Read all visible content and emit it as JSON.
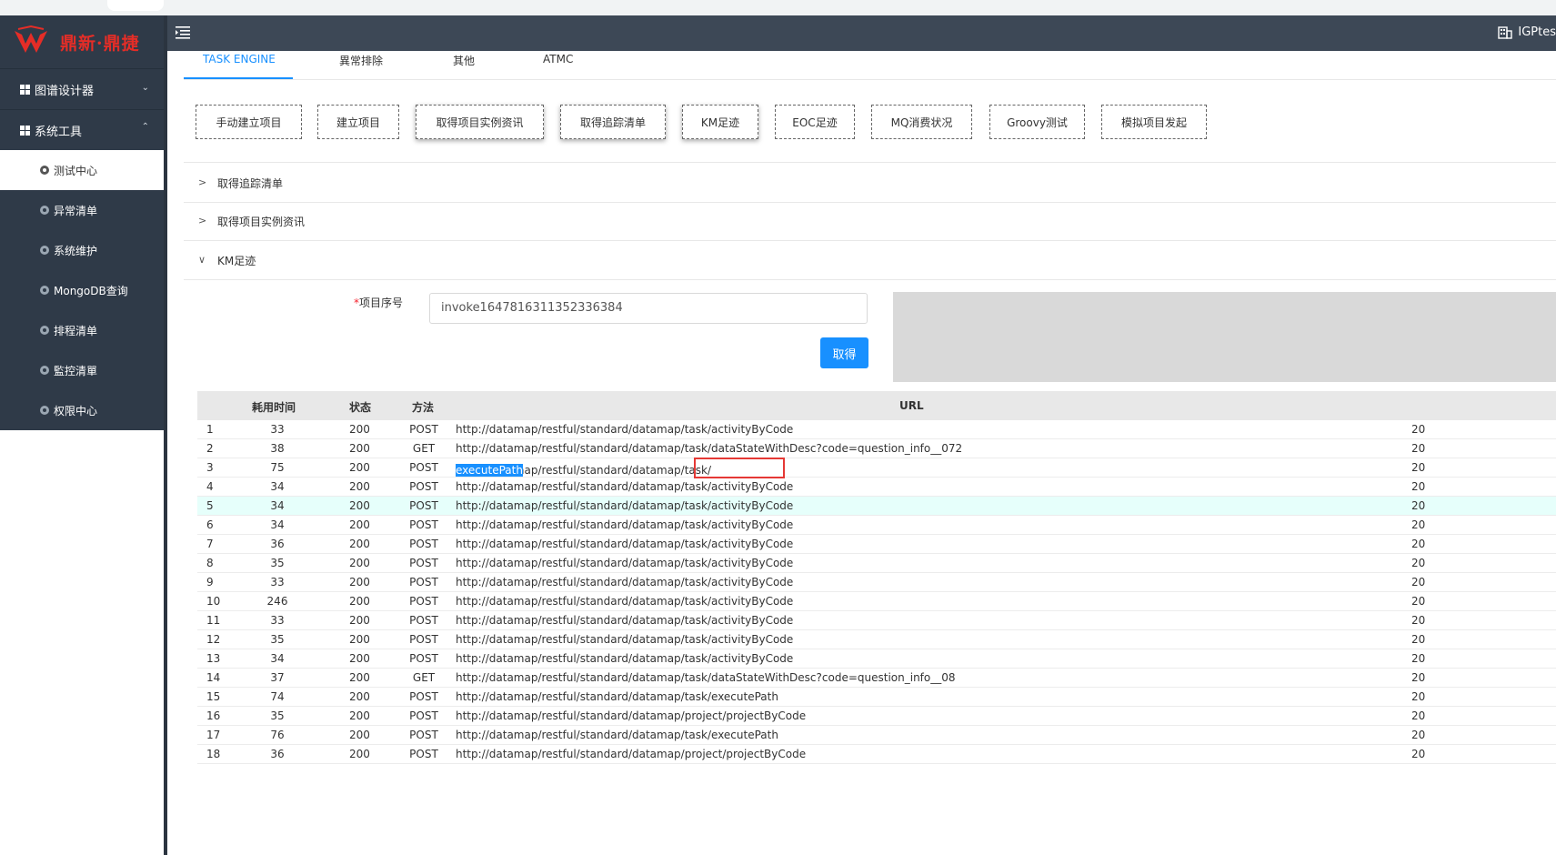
{
  "brand": {
    "logo_text": "鼎新·鼎捷",
    "accent": "#e52d27"
  },
  "header": {
    "tenant": "IGPtes"
  },
  "sidebar": {
    "groups": [
      {
        "label": "图谱设计器",
        "expanded": false
      },
      {
        "label": "系统工具",
        "expanded": true
      }
    ],
    "items": [
      {
        "label": "测试中心",
        "active": true
      },
      {
        "label": "异常清单"
      },
      {
        "label": "系统维护"
      },
      {
        "label": "MongoDB查询"
      },
      {
        "label": "排程清单"
      },
      {
        "label": "監控清單"
      },
      {
        "label": "权限中心"
      }
    ]
  },
  "tabs": [
    {
      "label": "TASK ENGINE",
      "active": true
    },
    {
      "label": "異常排除"
    },
    {
      "label": "其他"
    },
    {
      "label": "ATMC"
    }
  ],
  "actions": [
    "手动建立项目",
    "建立项目",
    "取得项目实例资讯",
    "取得追踪清单",
    "KM足迹",
    "EOC足迹",
    "MQ消费状况",
    "Groovy测试",
    "模拟项目发起"
  ],
  "panels": [
    {
      "title": "取得追踪清单",
      "expanded": false,
      "arrow": ">"
    },
    {
      "title": "取得项目实例资讯",
      "expanded": false,
      "arrow": ">"
    },
    {
      "title": "KM足迹",
      "expanded": true,
      "arrow": "∨"
    }
  ],
  "form": {
    "required_mark": "*",
    "label": "项目序号",
    "value": "invoke1647816311352336384",
    "submit": "取得"
  },
  "table": {
    "headers": {
      "time": "耗用时间",
      "status": "状态",
      "method": "方法",
      "url": "URL"
    },
    "rows": [
      {
        "idx": "1",
        "time": "33",
        "status": "200",
        "method": "POST",
        "url": "http://datamap/restful/standard/datamap/task/activityByCode",
        "date": "20"
      },
      {
        "idx": "2",
        "time": "38",
        "status": "200",
        "method": "GET",
        "url": "http://datamap/restful/standard/datamap/task/dataStateWithDesc?code=question_info__072",
        "date": "20"
      },
      {
        "idx": "3",
        "time": "75",
        "status": "200",
        "method": "POST",
        "url_prefix": "http://datamap/restful/standard/datamap/task/",
        "url_selected": "executePath",
        "date": "20"
      },
      {
        "idx": "4",
        "time": "34",
        "status": "200",
        "method": "POST",
        "url": "http://datamap/restful/standard/datamap/task/activityByCode",
        "date": "20"
      },
      {
        "idx": "5",
        "time": "34",
        "status": "200",
        "method": "POST",
        "url": "http://datamap/restful/standard/datamap/task/activityByCode",
        "date": "20"
      },
      {
        "idx": "6",
        "time": "34",
        "status": "200",
        "method": "POST",
        "url": "http://datamap/restful/standard/datamap/task/activityByCode",
        "date": "20"
      },
      {
        "idx": "7",
        "time": "36",
        "status": "200",
        "method": "POST",
        "url": "http://datamap/restful/standard/datamap/task/activityByCode",
        "date": "20"
      },
      {
        "idx": "8",
        "time": "35",
        "status": "200",
        "method": "POST",
        "url": "http://datamap/restful/standard/datamap/task/activityByCode",
        "date": "20"
      },
      {
        "idx": "9",
        "time": "33",
        "status": "200",
        "method": "POST",
        "url": "http://datamap/restful/standard/datamap/task/activityByCode",
        "date": "20"
      },
      {
        "idx": "10",
        "time": "246",
        "status": "200",
        "method": "POST",
        "url": "http://datamap/restful/standard/datamap/task/activityByCode",
        "date": "20"
      },
      {
        "idx": "11",
        "time": "33",
        "status": "200",
        "method": "POST",
        "url": "http://datamap/restful/standard/datamap/task/activityByCode",
        "date": "20"
      },
      {
        "idx": "12",
        "time": "35",
        "status": "200",
        "method": "POST",
        "url": "http://datamap/restful/standard/datamap/task/activityByCode",
        "date": "20"
      },
      {
        "idx": "13",
        "time": "34",
        "status": "200",
        "method": "POST",
        "url": "http://datamap/restful/standard/datamap/task/activityByCode",
        "date": "20"
      },
      {
        "idx": "14",
        "time": "37",
        "status": "200",
        "method": "GET",
        "url": "http://datamap/restful/standard/datamap/task/dataStateWithDesc?code=question_info__08",
        "date": "20"
      },
      {
        "idx": "15",
        "time": "74",
        "status": "200",
        "method": "POST",
        "url": "http://datamap/restful/standard/datamap/task/executePath",
        "date": "20"
      },
      {
        "idx": "16",
        "time": "35",
        "status": "200",
        "method": "POST",
        "url": "http://datamap/restful/standard/datamap/project/projectByCode",
        "date": "20"
      },
      {
        "idx": "17",
        "time": "76",
        "status": "200",
        "method": "POST",
        "url": "http://datamap/restful/standard/datamap/task/executePath",
        "date": "20"
      },
      {
        "idx": "18",
        "time": "36",
        "status": "200",
        "method": "POST",
        "url": "http://datamap/restful/standard/datamap/project/projectByCode",
        "date": "20"
      }
    ]
  }
}
